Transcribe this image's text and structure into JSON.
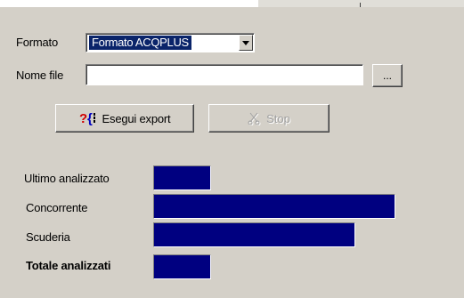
{
  "form": {
    "formato_label": "Formato",
    "formato_value": "Formato ACQPLUS",
    "nome_file_label": "Nome file",
    "nome_file_value": "",
    "browse_label": "...",
    "export_label": "Esegui export",
    "stop_label": "Stop"
  },
  "stats": {
    "ultimo_label": "Ultimo analizzato",
    "concorrente_label": "Concorrente",
    "scuderia_label": "Scuderia",
    "totale_label": "Totale analizzati"
  },
  "icons": {
    "export": "export-query-icon",
    "stop": "stop-scissors-icon",
    "dropdown": "chevron-down-icon"
  },
  "colors": {
    "window": "#d4d0c8",
    "selection": "#0a246a",
    "bar_fill": "#000080"
  }
}
